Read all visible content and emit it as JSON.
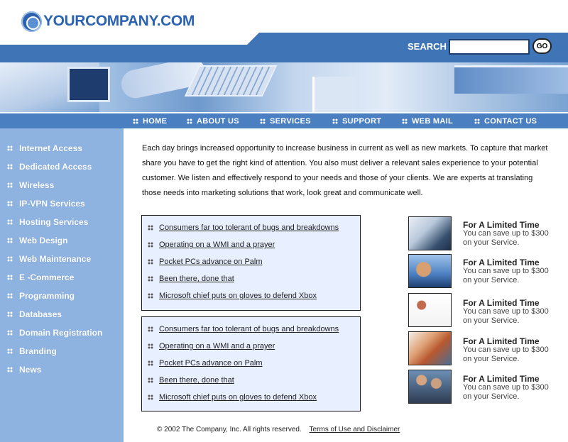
{
  "header": {
    "brand": "YOURCOMPANY.COM",
    "search_label": "SEARCH",
    "search_value": "",
    "go_label": "GO"
  },
  "nav": {
    "items": [
      {
        "label": "HOME"
      },
      {
        "label": "ABOUT US"
      },
      {
        "label": "SERVICES"
      },
      {
        "label": "SUPPORT"
      },
      {
        "label": "WEB MAIL"
      },
      {
        "label": "CONTACT US"
      }
    ]
  },
  "sidebar": {
    "items": [
      {
        "label": "Internet Access"
      },
      {
        "label": "Dedicated Access"
      },
      {
        "label": "Wireless"
      },
      {
        "label": "IP-VPN Services"
      },
      {
        "label": "Hosting Services"
      },
      {
        "label": "Web Design"
      },
      {
        "label": "Web Maintenance"
      },
      {
        "label": "E -Commerce"
      },
      {
        "label": "Programming"
      },
      {
        "label": "Databases"
      },
      {
        "label": "Domain Registration"
      },
      {
        "label": "Branding"
      },
      {
        "label": "News"
      }
    ]
  },
  "intro": {
    "text": "Each day brings increased opportunity to increase business in current as well as new markets. To capture that market share you have to get the right kind of attention. You also must deliver a relevant sales experience to your potential customer. We listen and effectively respond to your needs and those of your clients. We are experts at translating those needs into marketing solutions that work, look great and communicate well."
  },
  "news_boxes": [
    {
      "links": [
        {
          "label": "Consumers far too tolerant of bugs and breakdowns"
        },
        {
          "label": "Operating on a WMI and a prayer"
        },
        {
          "label": "Pocket PCs advance on Palm"
        },
        {
          "label": "Been there, done that"
        },
        {
          "label": "Microsoft chief puts on gloves to defend Xbox"
        }
      ]
    },
    {
      "links": [
        {
          "label": "Consumers far too tolerant of bugs and breakdowns"
        },
        {
          "label": "Operating on a WMI and a prayer"
        },
        {
          "label": "Pocket PCs advance on Palm"
        },
        {
          "label": "Been there, done that"
        },
        {
          "label": "Microsoft chief puts on gloves to defend Xbox"
        }
      ]
    }
  ],
  "promos": [
    {
      "title": "For A Limited Time",
      "text": "You can save up to $300 on your Service."
    },
    {
      "title": "For A Limited Time",
      "text": "You can save up to $300 on your Service."
    },
    {
      "title": "For A Limited Time",
      "text": "You can save up to $300 on your Service."
    },
    {
      "title": "For A Limited Time",
      "text": "You can save up to $300 on your Service."
    },
    {
      "title": "For A Limited Time",
      "text": "You can save up to $300 on your Service."
    }
  ],
  "footer": {
    "copyright": "© 2002 The Company, Inc. All rights reserved.",
    "terms_label": "Terms of Use and Disclaimer"
  },
  "colors": {
    "brand_blue": "#2b63b0",
    "nav_blue": "#4a80c2",
    "sidebar_blue": "#8fb3e1",
    "news_box_bg": "#e8efff"
  }
}
